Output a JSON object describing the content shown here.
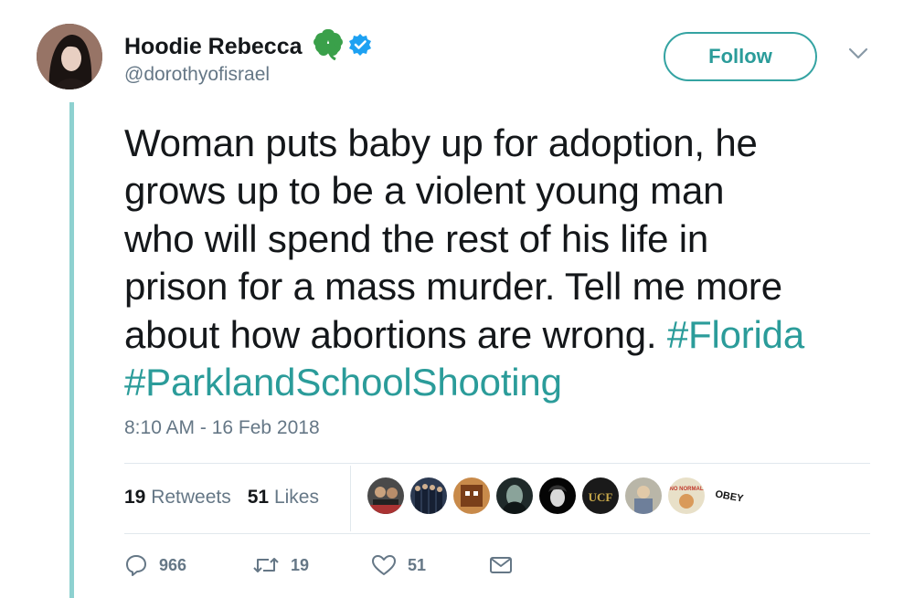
{
  "user": {
    "name": "Hoodie Rebecca",
    "handle": "@dorothyofisrael",
    "emoji": "clover-emoji",
    "verified": true
  },
  "follow_button": {
    "label": "Follow"
  },
  "tweet": {
    "lines": [
      "Woman puts baby up for adoption, he",
      "grows up to be a violent young man",
      "who will spend the rest of his life in",
      "prison for a mass murder. Tell me more",
      "about how abortions are wrong. "
    ],
    "hashtag_1": "#Florida",
    "hashtag_2": "#ParklandSchoolShooting"
  },
  "timestamp": "8:10 AM - 16 Feb 2018",
  "stats": {
    "retweets_count": "19",
    "retweets_label": "Retweets",
    "likes_count": "51",
    "likes_label": "Likes"
  },
  "liker_avatars": [
    "liker-avatar",
    "liker-avatar",
    "liker-avatar",
    "liker-avatar",
    "liker-avatar",
    "liker-avatar",
    "liker-avatar",
    "liker-avatar",
    "liker-avatar"
  ],
  "liker_avatar_text": {
    "ucf": "UCF",
    "no_normal": "NO NORMAL",
    "obey": "OBEY"
  },
  "actions": {
    "replies": "966",
    "retweets": "19",
    "likes": "51"
  },
  "colors": {
    "accent": "#2b9c9a",
    "thread_line": "#8ed1d0",
    "verified": "#1da1f2",
    "clover": "#3aa04a",
    "secondary_text": "#657786"
  }
}
